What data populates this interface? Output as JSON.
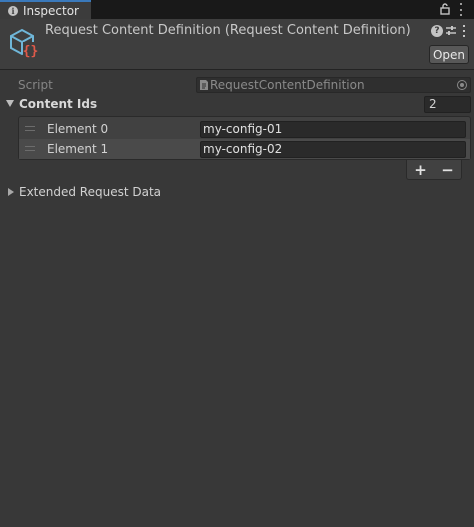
{
  "tab": {
    "title": "Inspector"
  },
  "header": {
    "title": "Request Content Definition (Request Content Definition)",
    "open_button": "Open"
  },
  "script": {
    "label": "Script",
    "value": "RequestContentDefinition"
  },
  "content_ids": {
    "label": "Content Ids",
    "size": "2",
    "elements": [
      {
        "label": "Element 0",
        "value": "my-config-01"
      },
      {
        "label": "Element 1",
        "value": "my-config-02"
      }
    ],
    "add_label": "+",
    "remove_label": "−"
  },
  "extended": {
    "label": "Extended Request Data"
  },
  "colors": {
    "tab_accent": "#3a79bb",
    "asset_icon_primary": "#6fb6d8",
    "asset_icon_accent": "#e05a4a"
  }
}
